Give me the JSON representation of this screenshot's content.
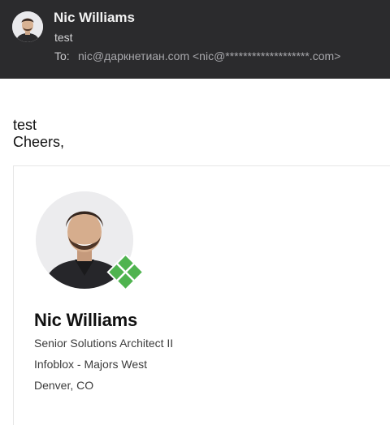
{
  "message": {
    "sender_name": "Nic Williams",
    "subject": "test",
    "to_label": "To:",
    "to_value": "nic@даркнетиан.com <nic@*******************.com>",
    "avatar_icon": "person-avatar-icon"
  },
  "body": {
    "line1": "test",
    "line2": "Cheers,"
  },
  "signature": {
    "name": "Nic Williams",
    "title": "Senior Solutions Architect II",
    "company": "Infoblox - Majors West",
    "location": "Denver, CO",
    "photo_icon": "person-photo-icon",
    "badge_icon": "infoblox-logo-icon",
    "badge_color": "#4fb34f"
  },
  "colors": {
    "header_bg": "#2b2b2d",
    "header_text": "#f2f2f2",
    "body_text": "#111111"
  }
}
